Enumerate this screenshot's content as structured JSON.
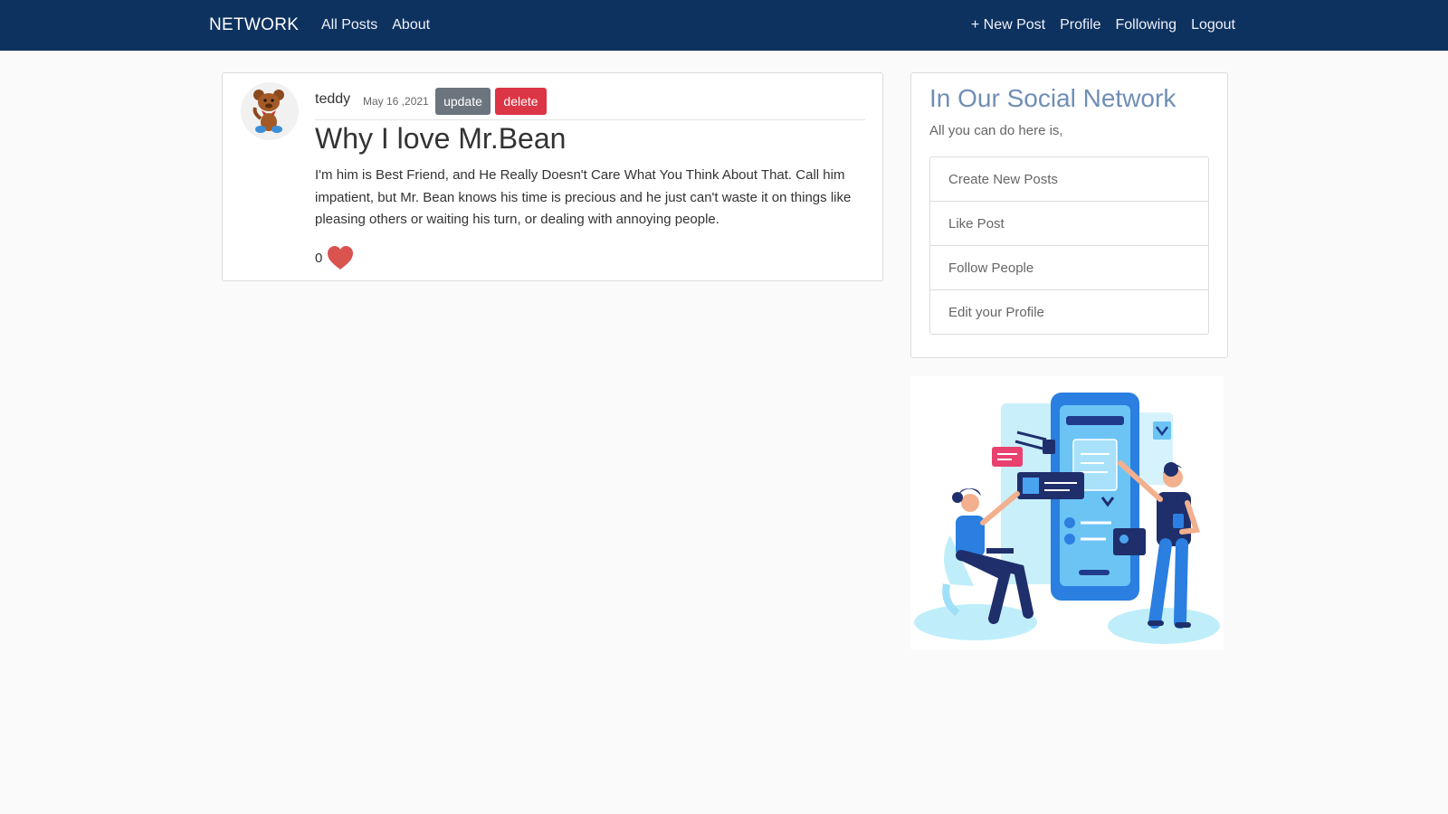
{
  "navbar": {
    "brand": "NETWORK",
    "left_links": [
      "All Posts",
      "About"
    ],
    "right_links": [
      "+ New Post",
      "Profile",
      "Following",
      "Logout"
    ],
    "bg_color": "#0e3260"
  },
  "post": {
    "author": "teddy",
    "date": "May 16 ,2021",
    "update_label": "update",
    "delete_label": "delete",
    "title": "Why I love Mr.Bean",
    "body": "I'm him is Best Friend, and He Really Doesn't Care What You Think About That. Call him impatient, but Mr. Bean knows his time is precious and he just can't waste it on things like pleasing others or waiting his turn, or dealing with annoying people.",
    "like_count": "0",
    "avatar_icon": "teddy-bear-icon",
    "like_icon": "heart-icon",
    "heart_color": "#d9534f"
  },
  "sidebar": {
    "title": "In Our Social Network",
    "subtitle": "All you can do here is,",
    "features": [
      "Create New Posts",
      "Like Post",
      "Follow People",
      "Edit your Profile"
    ],
    "title_color": "#6f8eb6"
  },
  "illustration": {
    "icon": "social-network-illustration"
  }
}
